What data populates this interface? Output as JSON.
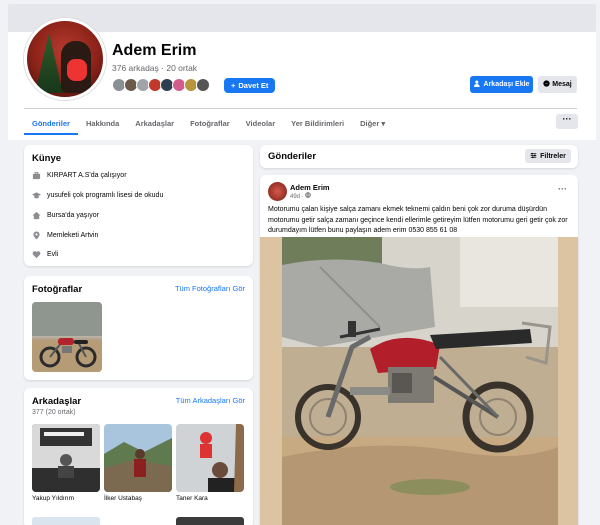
{
  "profile": {
    "name": "Adem Erim",
    "counts": "376 arkadaş · 20 ortak",
    "story_button": "Davet Et",
    "add_friend_button": "Arkadaşı Ekle",
    "message_button": "Mesaj"
  },
  "tabs": [
    "Gönderiler",
    "Hakkında",
    "Arkadaşlar",
    "Fotoğraflar",
    "Videolar",
    "Yer Bildirimleri",
    "Diğer"
  ],
  "more_button": "···",
  "intro": {
    "title": "Künye",
    "items": [
      {
        "icon": "briefcase-icon",
        "text": "KIRPART A.S'da çalışıyor"
      },
      {
        "icon": "graduation-cap-icon",
        "text": "yusufeli çok programlı lisesi de okudu"
      },
      {
        "icon": "home-icon",
        "text": "Bursa'da yaşıyor"
      },
      {
        "icon": "location-pin-icon",
        "text": "Memleketi Artvin"
      },
      {
        "icon": "heart-icon",
        "text": "Evli"
      }
    ]
  },
  "photos": {
    "title": "Fotoğraflar",
    "see_all": "Tüm Fotoğrafları Gör"
  },
  "friends": {
    "title": "Arkadaşlar",
    "see_all": "Tüm Arkadaşları Gör",
    "sub": "377 (20 ortak)",
    "items": [
      {
        "name": "Yakup Yıldırım"
      },
      {
        "name": "İlker Ustabaş"
      },
      {
        "name": "Taner Kara"
      }
    ]
  },
  "posts": {
    "title": "Gönderiler",
    "filters_button": "Filtreler"
  },
  "post": {
    "author": "Adem Erim",
    "time": "49d · ",
    "text": "Motorumu çalan kişiye salça zamanı ekmek teknemi çaldın beni çok zor duruma düşürdün motorumu getir salça zamanı geçince kendi ellerimle getireyim lütfen motorumu geri getir çok zor durumdayım lütfen bunu paylaşın adem erim 0530 855 61 08",
    "dots": "···"
  },
  "colors": {
    "accent": "#1877f2",
    "background": "#f0f2f5",
    "secondary_text": "#65676b"
  }
}
